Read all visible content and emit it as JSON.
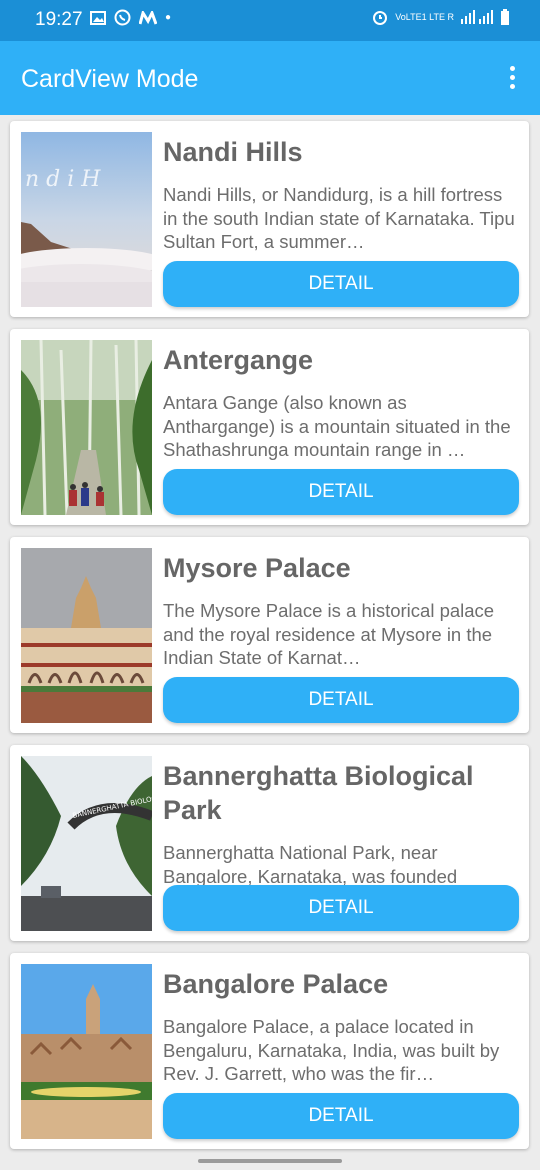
{
  "status": {
    "time": "19:27",
    "network_label": "VoLTE1 LTE R"
  },
  "appbar": {
    "title": "CardView Mode"
  },
  "cards": [
    {
      "title": "Nandi Hills",
      "description": "Nandi Hills, or Nandidurg, is a hill fortress in the south Indian state of Karnataka. Tipu Sultan Fort, a summer…",
      "button": "DETAIL",
      "image_text": "n d i  H"
    },
    {
      "title": "Antergange",
      "description": "Antara Gange (also known as Anthargange) is a mountain situated in the Shathashrunga mountain range in …",
      "button": "DETAIL"
    },
    {
      "title": "Mysore Palace",
      "description": "The Mysore Palace is a historical palace and the royal residence at Mysore in the Indian State of Karnat…",
      "button": "DETAIL"
    },
    {
      "title": "Bannerghatta Biological Park",
      "description": "Bannerghatta National Park, near Bangalore, Karnataka, was founded",
      "button": "DETAIL",
      "image_text": "BANNERGHATTA BIOLOGICAL"
    },
    {
      "title": "Bangalore Palace",
      "description": "Bangalore Palace, a palace located in Bengaluru, Karnataka, India, was built by Rev. J. Garrett, who was the fir…",
      "button": "DETAIL"
    }
  ]
}
